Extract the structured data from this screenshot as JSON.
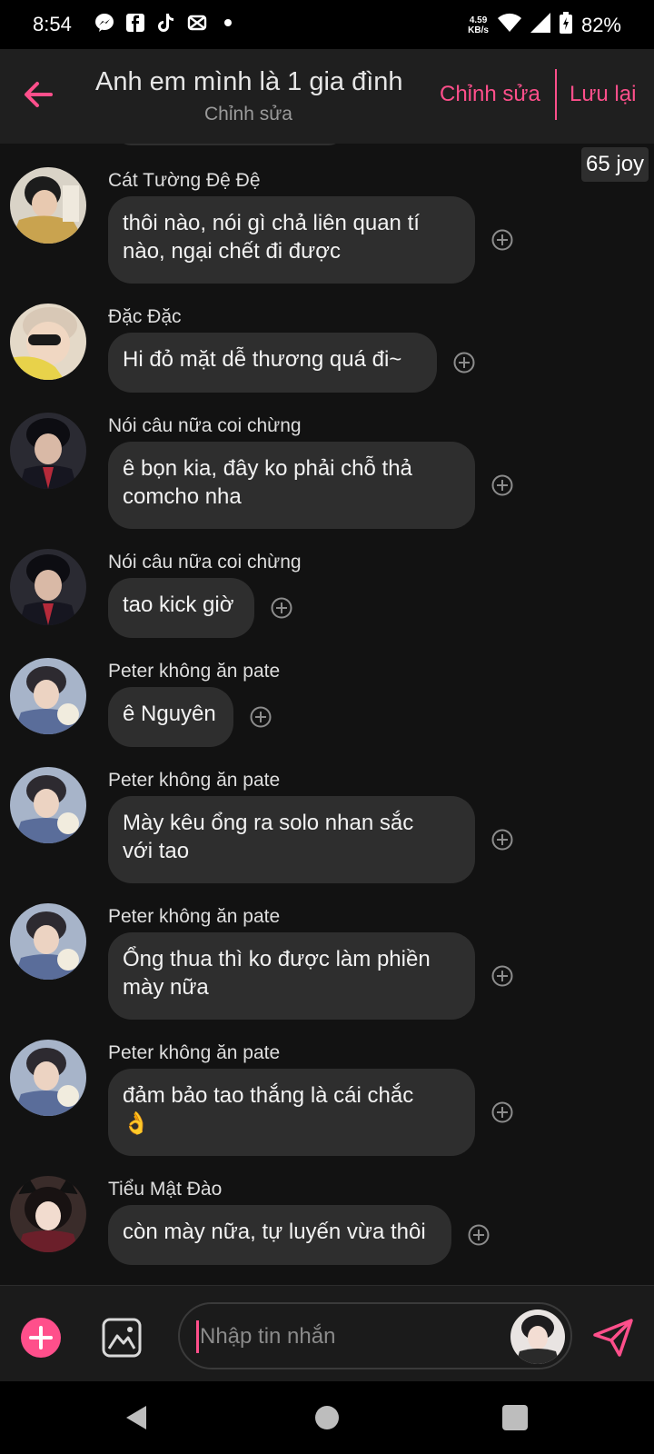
{
  "status_bar": {
    "time": "8:54",
    "net_speed_value": "4.59",
    "net_speed_unit": "KB/s",
    "battery": "82%",
    "icons": [
      "messenger-icon",
      "facebook-icon",
      "tiktok-icon",
      "capcut-icon",
      "dot-icon",
      "wifi-icon",
      "signal-icon",
      "battery-icon"
    ]
  },
  "header": {
    "title": "Anh em mình là 1 gia đình",
    "subtitle": "Chỉnh sửa",
    "edit_label": "Chỉnh sửa",
    "save_label": "Lưu lại"
  },
  "joy_badge": "65 joy",
  "messages": [
    {
      "sender": "Cát Tường Đệ Đệ",
      "line1": "thôi nào, nói gì chả liên quan tí",
      "line2": "nào, ngại chết đi được"
    },
    {
      "sender": "Đặc Đặc",
      "line1": "Hi đỏ mặt dễ thương quá đi~"
    },
    {
      "sender": "Nói câu nữa coi chừng",
      "line1": "ê bọn kia, đây ko phải chỗ thả",
      "line2": "comcho nha"
    },
    {
      "sender": "Nói câu nữa coi chừng",
      "line1": "tao kick giờ"
    },
    {
      "sender": "Peter không ăn pate",
      "line1": "ê Nguyên"
    },
    {
      "sender": "Peter không ăn pate",
      "line1": "Mày kêu ổng ra solo nhan sắc",
      "line2": "với tao"
    },
    {
      "sender": "Peter không ăn pate",
      "line1": "Ổng thua thì ko được làm phiền",
      "line2": "mày nữa"
    },
    {
      "sender": "Peter không ăn pate",
      "line1": "đảm bảo tao thắng là cái chắc",
      "line2": "👌"
    },
    {
      "sender": "Tiểu Mật Đào",
      "line1": "còn mày nữa, tự luyến vừa thôi"
    }
  ],
  "composer": {
    "placeholder": "Nhập tin nhắn"
  },
  "colors": {
    "accent": "#ff4f8b",
    "bubble": "#2e2e2e",
    "background": "#121212",
    "header": "#1f1f1f"
  }
}
